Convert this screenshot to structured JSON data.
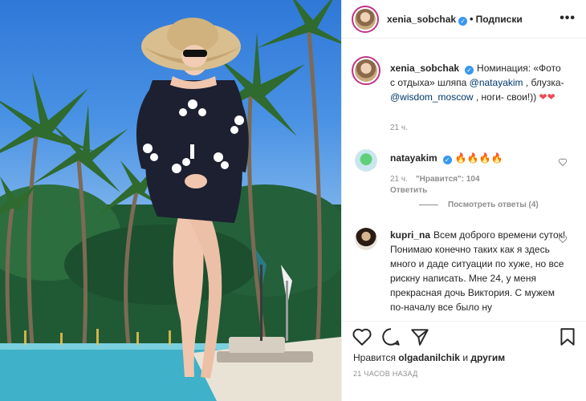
{
  "post": {
    "author": "xenia_sobchak",
    "separator": "•",
    "follow_status": "Подписки",
    "more_icon": "ellipsis-icon"
  },
  "caption": {
    "author": "xenia_sobchak",
    "text_1": "Номинация: «Фото с отдыха» шляпа ",
    "mention_1": "@natayakim",
    "text_2": " , блузка- ",
    "mention_2": "@wisdom_moscow",
    "text_3": " , ноги- свои!)) ",
    "hearts": "❤❤",
    "time": "21 ч."
  },
  "comments": [
    {
      "author": "natayakim",
      "text": "🔥🔥🔥🔥",
      "time": "21 ч.",
      "likes": "\"Нравится\": 104",
      "reply": "Ответить",
      "view_replies": "Посмотреть ответы (4)"
    },
    {
      "author": "kupri_na",
      "text": "Всем доброго времени суток! Понимаю конечно таких как я здесь много и даде ситуации по хуже, но все рискну написать. Мне 24, у меня прекрасная дочь Виктория. С мужем по-началу все было ну"
    }
  ],
  "footer": {
    "likes_prefix": "Нравится ",
    "likes_user": "olgadanilchik",
    "likes_and": " и ",
    "likes_others": "другим",
    "time": "21 ЧАСОВ НАЗАД"
  },
  "icons": {
    "like": "heart-icon",
    "comment": "comment-icon",
    "share": "share-icon",
    "save": "bookmark-icon"
  },
  "colors": {
    "verified": "#3897f0",
    "mention": "#00376b",
    "muted": "#8e8e8e",
    "story_ring": "#c13584"
  }
}
